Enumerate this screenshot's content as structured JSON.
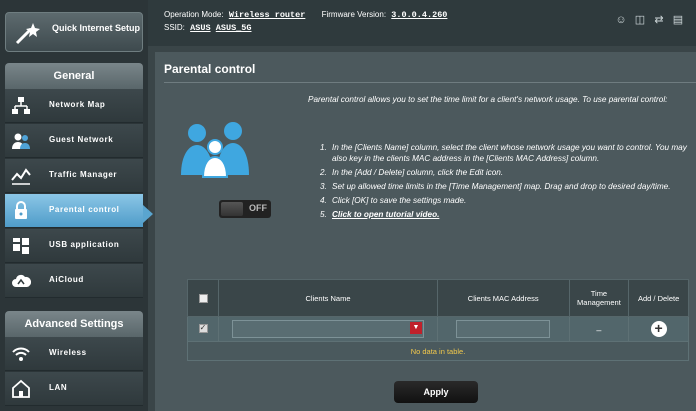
{
  "sidebar": {
    "quick_setup_label": "Quick Internet Setup",
    "general_header": "General",
    "items": [
      {
        "label": "Network Map",
        "icon": "network-map-icon"
      },
      {
        "label": "Guest Network",
        "icon": "guest-network-icon"
      },
      {
        "label": "Traffic Manager",
        "icon": "traffic-manager-icon"
      },
      {
        "label": "Parental control",
        "icon": "parental-control-icon",
        "active": true
      },
      {
        "label": "USB application",
        "icon": "usb-application-icon"
      },
      {
        "label": "AiCloud",
        "icon": "aicloud-icon"
      }
    ],
    "advanced_header": "Advanced Settings",
    "advanced_items": [
      {
        "label": "Wireless",
        "icon": "wireless-icon"
      },
      {
        "label": "LAN",
        "icon": "lan-icon"
      }
    ]
  },
  "header": {
    "operation_mode_label": "Operation Mode:",
    "operation_mode_value": "Wireless router",
    "firmware_label": "Firmware Version:",
    "firmware_value": "3.0.0.4.260",
    "ssid_label": "SSID:",
    "ssid_1": "ASUS",
    "ssid_2": "ASUS_5G",
    "icons": [
      "clients-icon",
      "usb-status-icon",
      "network-status-icon",
      "printer-icon"
    ]
  },
  "panel": {
    "title": "Parental control",
    "toggle_state": "OFF",
    "description": "Parental control allows you to set the time limit for a client's network usage. To use parental control:",
    "steps": [
      {
        "num": "1.",
        "text": "In the [Clients Name] column, select the client whose network usage you want to control. You may also key in the clients MAC address in the [Clients MAC Address] column."
      },
      {
        "num": "2.",
        "text": "In the [Add / Delete] column, click the Edit icon."
      },
      {
        "num": "3.",
        "text": "Set up allowed time limits in the [Time Management] map. Drag and drop to desired day/time."
      },
      {
        "num": "4.",
        "text": "Click [OK] to save the settings made."
      },
      {
        "num": "5.",
        "link": "Click to open tutorial video."
      }
    ]
  },
  "table": {
    "headers": {
      "clients_name": "Clients Name",
      "clients_mac": "Clients MAC Address",
      "time_management": "Time Management",
      "add_delete": "Add / Delete"
    },
    "time_placeholder": "–",
    "no_data": "No data in table."
  },
  "apply_label": "Apply",
  "colors": {
    "accent": "#4f9cc9",
    "no_data_text": "#f2c94c",
    "dropdown_red": "#c0212b"
  }
}
